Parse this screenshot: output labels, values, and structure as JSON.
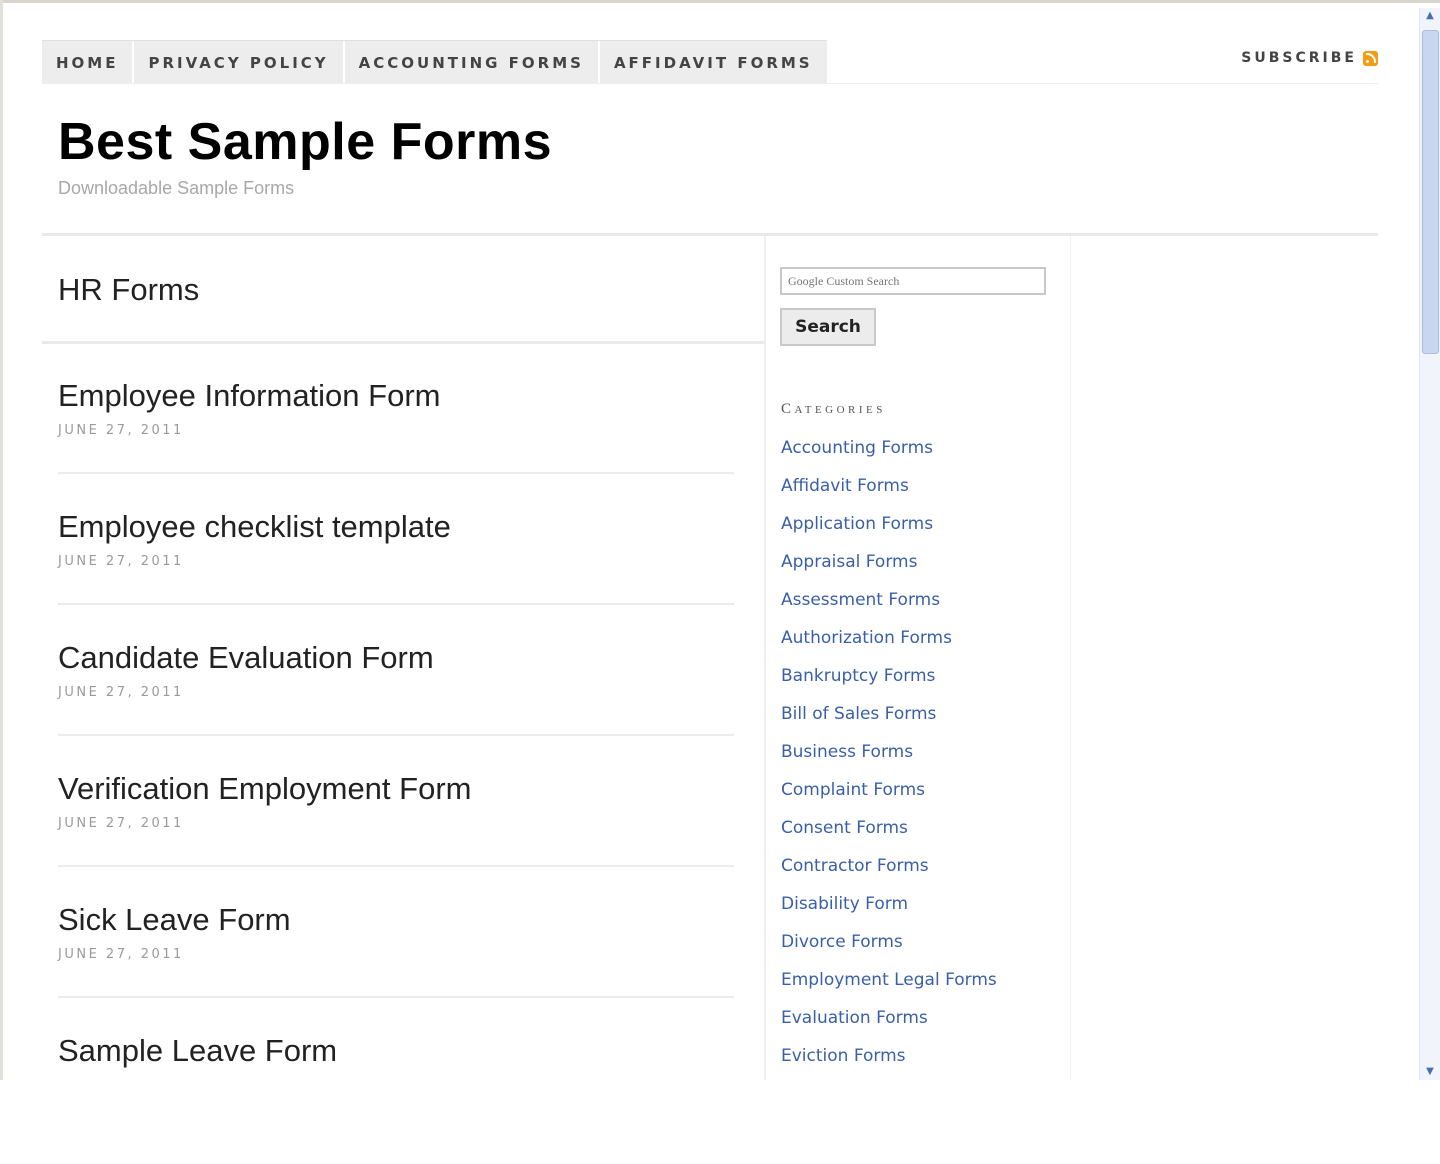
{
  "nav": {
    "items": [
      "HOME",
      "PRIVACY POLICY",
      "ACCOUNTING FORMS",
      "AFFIDAVIT FORMS"
    ],
    "subscribe_label": "SUBSCRIBE"
  },
  "site": {
    "title": "Best Sample Forms",
    "tagline": "Downloadable Sample Forms"
  },
  "main": {
    "section_title": "HR Forms",
    "posts": [
      {
        "title": "Employee Information Form",
        "date": "JUNE 27, 2011"
      },
      {
        "title": "Employee checklist template",
        "date": "JUNE 27, 2011"
      },
      {
        "title": "Candidate Evaluation Form",
        "date": "JUNE 27, 2011"
      },
      {
        "title": "Verification Employment Form",
        "date": "JUNE 27, 2011"
      },
      {
        "title": "Sick Leave Form",
        "date": "JUNE 27, 2011"
      },
      {
        "title": "Sample Leave Form",
        "date": ""
      }
    ]
  },
  "sidebar": {
    "search": {
      "placeholder": "Google Custom Search",
      "button_label": "Search"
    },
    "categories_heading": "Categories",
    "categories": [
      "Accounting Forms",
      "Affidavit Forms",
      "Application Forms",
      "Appraisal Forms",
      "Assessment Forms",
      "Authorization Forms",
      "Bankruptcy Forms",
      "Bill of Sales Forms",
      "Business Forms",
      "Complaint Forms",
      "Consent Forms",
      "Contractor Forms",
      "Disability Form",
      "Divorce Forms",
      "Employment Legal Forms",
      "Evaluation Forms",
      "Eviction Forms"
    ]
  },
  "colors": {
    "link": "#3a5fa8",
    "nav_bg": "#ededed",
    "rss": "#f39c12",
    "scrollbar_thumb": "#c9d6f0"
  },
  "icons": [
    "rss-icon",
    "scroll-up-arrow-icon",
    "scroll-down-arrow-icon"
  ]
}
